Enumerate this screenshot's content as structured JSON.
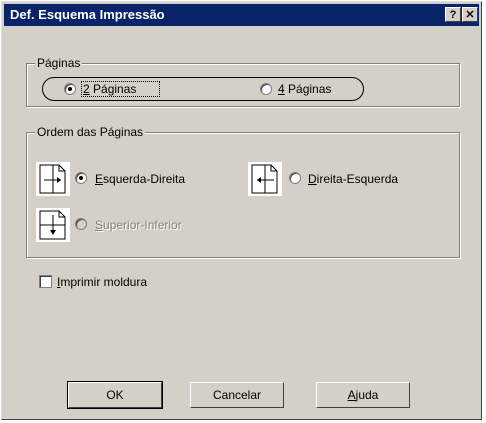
{
  "window": {
    "title": "Def. Esquema Impressão",
    "help_glyph": "?",
    "close_glyph": "✕"
  },
  "paginas": {
    "legend": "Páginas",
    "options": [
      {
        "mnemonic": "2",
        "rest": " Páginas",
        "selected": true
      },
      {
        "mnemonic": "4",
        "rest": " Páginas",
        "selected": false
      }
    ]
  },
  "ordem": {
    "legend": "Ordem das Páginas",
    "options": [
      {
        "mnemonic": "E",
        "rest": "squerda-Direita",
        "selected": true,
        "enabled": true,
        "icon": "left-to-right-arrow-icon"
      },
      {
        "mnemonic": "D",
        "rest": "ireita-Esquerda",
        "selected": false,
        "enabled": true,
        "icon": "right-to-left-arrow-icon"
      },
      {
        "mnemonic": "S",
        "rest": "uperior-Inferior",
        "selected": false,
        "enabled": false,
        "icon": "top-to-bottom-arrow-icon"
      }
    ]
  },
  "moldura": {
    "mnemonic": "I",
    "rest": "mprimir moldura",
    "checked": false
  },
  "buttons": {
    "ok": "OK",
    "cancel": "Cancelar",
    "help_mnemonic": "A",
    "help_rest": "juda"
  },
  "colors": {
    "face": "#d4d0c8",
    "title_bar": "#0a246a",
    "disabled_text": "#808080"
  }
}
